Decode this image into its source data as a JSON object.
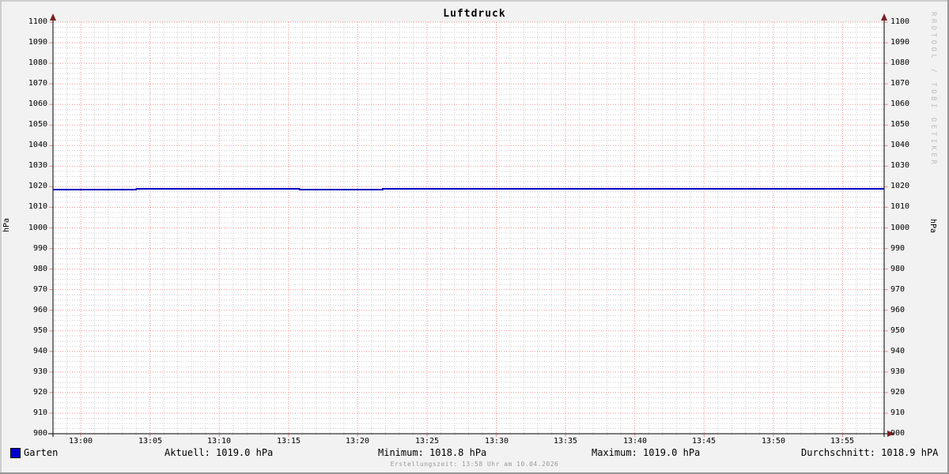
{
  "chart_data": {
    "type": "line",
    "title": "Luftdruck",
    "watermark": "RRDTOOL / TOBI OETIKER",
    "footer": "Erstellungszeit: 13:58 Uhr am 10.04.2026",
    "y_axis": {
      "unit_left": "hPa",
      "unit_right": "hPa",
      "min": 900,
      "max": 1100,
      "tick_step": 10,
      "minor_step": 2.5,
      "ticks": [
        900,
        910,
        920,
        930,
        940,
        950,
        960,
        970,
        980,
        990,
        1000,
        1010,
        1020,
        1030,
        1040,
        1050,
        1060,
        1070,
        1080,
        1090,
        1100
      ]
    },
    "x_axis": {
      "ticks": [
        "13:00",
        "13:05",
        "13:10",
        "13:15",
        "13:20",
        "13:25",
        "13:30",
        "13:35",
        "13:40",
        "13:45",
        "13:50",
        "13:55"
      ],
      "first_tick_minute": 2,
      "tick_interval_min": 5,
      "minor_interval_min": 1,
      "total_minutes": 60
    },
    "series": [
      {
        "name": "Garten",
        "color": "#0000c0",
        "segments": [
          {
            "from_min": 0,
            "to_min": 6,
            "value": 1018.8
          },
          {
            "from_min": 6,
            "to_min": 17.8,
            "value": 1019.0
          },
          {
            "from_min": 17.8,
            "to_min": 23.8,
            "value": 1018.8
          },
          {
            "from_min": 23.8,
            "to_min": 60,
            "value": 1019.0
          }
        ]
      }
    ],
    "stats": [
      "Aktuell: 1019.0 hPa",
      "Minimum: 1018.8 hPa",
      "Maximum: 1019.0 hPa",
      "Durchschnitt: 1018.9 hPA"
    ],
    "colors": {
      "line": "#0000c0",
      "legend_swatch": "#0000cc",
      "major_grid": "#ef9090",
      "minor_grid": "#cccccc",
      "axis": "#000000",
      "arrow": "#7a2020",
      "plot_bg": "#ffffff",
      "page_bg": "#f2f2f2",
      "watermark_text": "#bcbcbc",
      "footer_text": "#999999"
    }
  }
}
